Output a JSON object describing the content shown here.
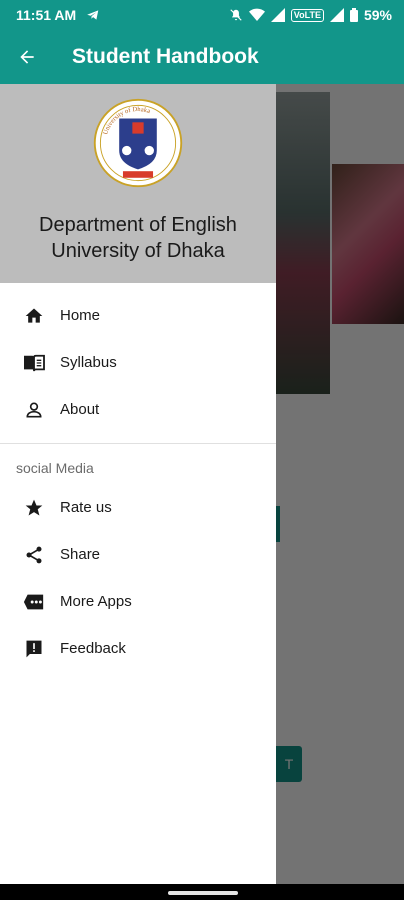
{
  "status_bar": {
    "time": "11:51 AM",
    "network_badge": "VoLTE",
    "battery": "59%"
  },
  "app_bar": {
    "title": "Student Handbook"
  },
  "drawer": {
    "header_title_line1": "Department of English",
    "header_title_line2": "University of Dhaka",
    "logo_text": "University of Dhaka",
    "main_items": [
      {
        "label": "Home",
        "icon": "home-icon"
      },
      {
        "label": "Syllabus",
        "icon": "book-icon"
      },
      {
        "label": "About",
        "icon": "person-icon"
      }
    ],
    "section_title": "social Media",
    "social_items": [
      {
        "label": "Rate us",
        "icon": "star-icon"
      },
      {
        "label": "Share",
        "icon": "share-icon"
      },
      {
        "label": "More Apps",
        "icon": "more-apps-icon"
      },
      {
        "label": "Feedback",
        "icon": "feedback-icon"
      }
    ]
  },
  "background": {
    "button_label": "T"
  },
  "colors": {
    "primary": "#12968a",
    "drawer_header": "#bcbcbc"
  }
}
